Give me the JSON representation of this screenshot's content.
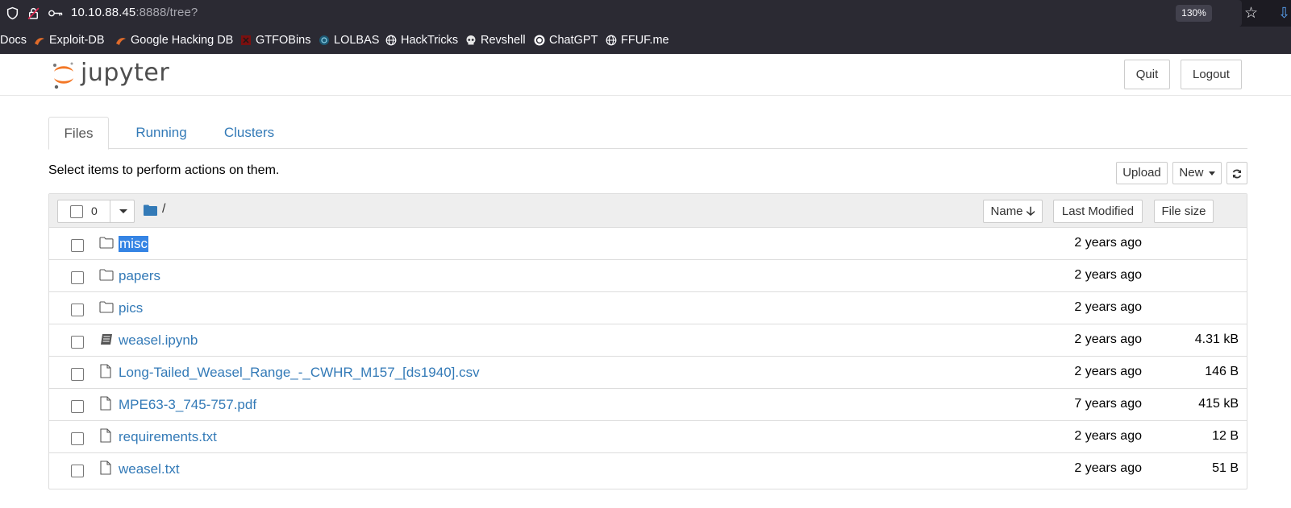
{
  "browser": {
    "url_host": "10.10.88.45",
    "url_path": ":8888/tree?",
    "zoom": "130%"
  },
  "bookmarks": [
    {
      "label": "Docs",
      "icon": "none"
    },
    {
      "label": "Exploit-DB",
      "icon": "exploitdb-icon"
    },
    {
      "label": "Google Hacking DB",
      "icon": "exploitdb-icon"
    },
    {
      "label": "GTFOBins",
      "icon": "gtfobins-icon"
    },
    {
      "label": "LOLBAS",
      "icon": "lolbas-icon"
    },
    {
      "label": "HackTricks",
      "icon": "globe-icon"
    },
    {
      "label": "Revshell",
      "icon": "skull-icon"
    },
    {
      "label": "ChatGPT",
      "icon": "chatgpt-icon"
    },
    {
      "label": "FFUF.me",
      "icon": "globe-icon"
    }
  ],
  "header": {
    "logo_text": "jupyter",
    "quit_label": "Quit",
    "logout_label": "Logout"
  },
  "tabs": [
    {
      "label": "Files",
      "active": true
    },
    {
      "label": "Running",
      "active": false
    },
    {
      "label": "Clusters",
      "active": false
    }
  ],
  "toolbar": {
    "hint": "Select items to perform actions on them.",
    "upload_label": "Upload",
    "new_label": "New",
    "refresh_icon": "refresh-icon"
  },
  "list_header": {
    "selected_count": "0",
    "path": "/",
    "name_label": "Name",
    "modified_label": "Last Modified",
    "size_label": "File size"
  },
  "files": [
    {
      "name": "misc",
      "type": "folder",
      "modified": "2 years ago",
      "size": "",
      "selected": true
    },
    {
      "name": "papers",
      "type": "folder",
      "modified": "2 years ago",
      "size": ""
    },
    {
      "name": "pics",
      "type": "folder",
      "modified": "2 years ago",
      "size": ""
    },
    {
      "name": "weasel.ipynb",
      "type": "notebook",
      "modified": "2 years ago",
      "size": "4.31 kB"
    },
    {
      "name": "Long-Tailed_Weasel_Range_-_CWHR_M157_[ds1940].csv",
      "type": "file",
      "modified": "2 years ago",
      "size": "146 B"
    },
    {
      "name": "MPE63-3_745-757.pdf",
      "type": "file",
      "modified": "7 years ago",
      "size": "415 kB"
    },
    {
      "name": "requirements.txt",
      "type": "file",
      "modified": "2 years ago",
      "size": "12 B"
    },
    {
      "name": "weasel.txt",
      "type": "file",
      "modified": "2 years ago",
      "size": "51 B"
    }
  ],
  "colors": {
    "link": "#337ab7",
    "selection": "#3584e4",
    "jupyter_orange": "#f37726"
  }
}
